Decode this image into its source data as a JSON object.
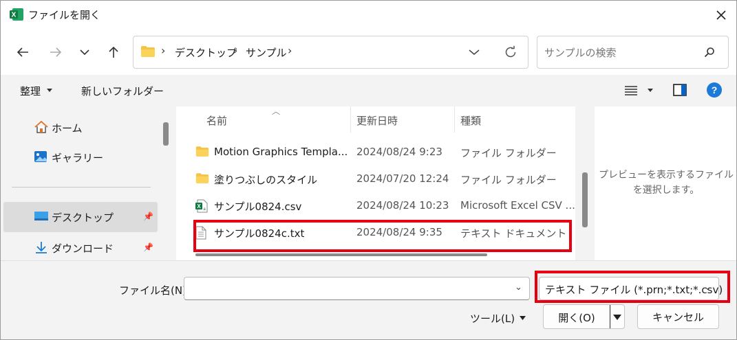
{
  "window": {
    "title": "ファイルを開く",
    "app_icon": "excel-icon",
    "close_icon": "close-icon"
  },
  "nav": {
    "back_icon": "back-arrow-icon",
    "forward_icon": "forward-arrow-icon",
    "recent_icon": "chevron-down-icon",
    "up_icon": "up-arrow-icon"
  },
  "address": {
    "crumbs": [
      "デスクトップ",
      "サンプル"
    ],
    "separator": "›"
  },
  "search": {
    "placeholder": "サンプルの検索"
  },
  "commandbar": {
    "organize": "整理",
    "new_folder": "新しいフォルダー"
  },
  "sidebar": {
    "items": [
      {
        "label": "ホーム",
        "icon": "home-icon"
      },
      {
        "label": "ギャラリー",
        "icon": "gallery-icon"
      },
      {
        "label": "デスクトップ",
        "icon": "desktop-icon",
        "selected": true,
        "pinned": true
      },
      {
        "label": "ダウンロード",
        "icon": "download-icon",
        "pinned": true
      }
    ]
  },
  "filelist": {
    "columns": {
      "name": "名前",
      "modified": "更新日時",
      "type": "種類"
    },
    "rows": [
      {
        "name": "Motion Graphics Templa...",
        "date": "2024/08/24 9:23",
        "type": "ファイル フォルダー",
        "icon": "folder-icon"
      },
      {
        "name": "塗りつぶしのスタイル",
        "date": "2024/07/20 12:24",
        "type": "ファイル フォルダー",
        "icon": "folder-icon"
      },
      {
        "name": "サンプル0824.csv",
        "date": "2024/08/24 10:23",
        "type": "Microsoft Excel CSV ...",
        "icon": "excel-csv-icon"
      },
      {
        "name": "サンプル0824c.txt",
        "date": "2024/08/24 9:35",
        "type": "テキスト ドキュメント",
        "icon": "text-document-icon"
      }
    ]
  },
  "preview": {
    "message": "プレビューを表示するファイルを選択します。"
  },
  "footer": {
    "filename_label": "ファイル名(N):",
    "filename_value": "",
    "filetype_selected": "テキスト ファイル (*.prn;*.txt;*.csv)",
    "tools_label": "ツール(L)",
    "open_label": "開く(O)",
    "cancel_label": "キャンセル"
  },
  "colors": {
    "highlight": "#e60012",
    "excel_green": "#107c41",
    "folder_yellow": "#f6c344",
    "accent_blue": "#0a62c2"
  }
}
